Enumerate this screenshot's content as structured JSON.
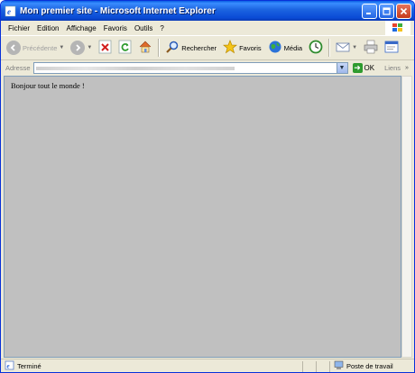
{
  "window": {
    "title": "Mon premier site - Microsoft Internet Explorer"
  },
  "menu": {
    "items": [
      "Fichier",
      "Edition",
      "Affichage",
      "Favoris",
      "Outils",
      "?"
    ]
  },
  "toolbar": {
    "back_label": "Précédente",
    "search_label": "Rechercher",
    "favorites_label": "Favoris",
    "media_label": "Média"
  },
  "address": {
    "label": "Adresse",
    "go_label": "OK",
    "links_label": "Liens"
  },
  "page": {
    "text": "Bonjour tout le monde !"
  },
  "status": {
    "text": "Terminé",
    "zone": "Poste de travail"
  },
  "colors": {
    "titlebar": "#0a4bd6",
    "page_background": "#c0c0c0",
    "chrome": "#ece9d8"
  }
}
